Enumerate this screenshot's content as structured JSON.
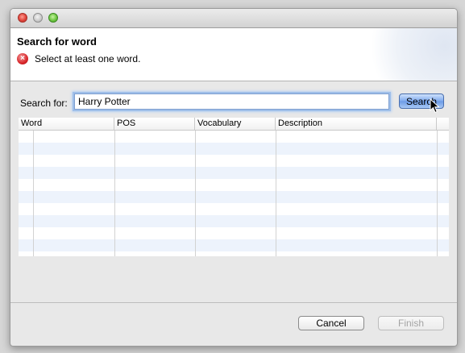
{
  "dialog": {
    "title": "Search for word",
    "error_message": "Select at least one word.",
    "error_icon": "error-x-icon"
  },
  "search": {
    "label": "Search for:",
    "value": "Harry Potter",
    "button_label": "Search"
  },
  "table": {
    "columns": [
      "Word",
      "POS",
      "Vocabulary",
      "Description"
    ],
    "rows": []
  },
  "footer": {
    "cancel_label": "Cancel",
    "finish_label": "Finish"
  },
  "colors": {
    "error": "#d7262a",
    "selection_accent": "#6b9ae6",
    "row_stripe": "#edf3fc"
  }
}
